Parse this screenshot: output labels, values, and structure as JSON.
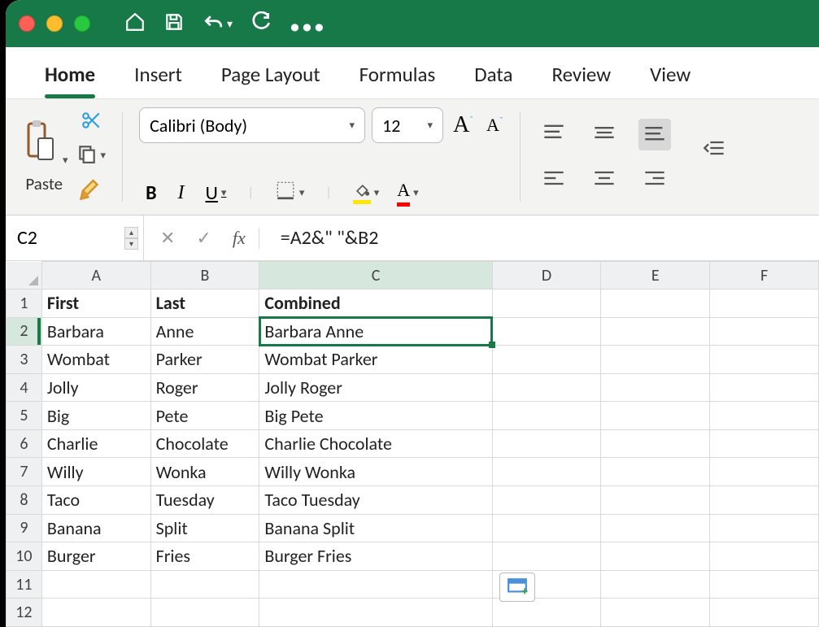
{
  "titlebar": {
    "traffic": [
      "red",
      "yellow",
      "green"
    ]
  },
  "tabs": {
    "items": [
      "Home",
      "Insert",
      "Page Layout",
      "Formulas",
      "Data",
      "Review",
      "View"
    ],
    "active": 0
  },
  "ribbon": {
    "paste_label": "Paste",
    "font_name": "Calibri (Body)",
    "font_size": "12",
    "bold": "B",
    "italic": "I",
    "underline": "U"
  },
  "namebox": "C2",
  "formula": "=A2&\" \"&B2",
  "fx_label": "fx",
  "columns": [
    "A",
    "B",
    "C",
    "D",
    "E",
    "F"
  ],
  "selected_col_index": 2,
  "selected_row_index": 1,
  "rows": [
    {
      "n": 1,
      "cells": [
        "First",
        "Last",
        "Combined",
        "",
        "",
        ""
      ],
      "bold": true
    },
    {
      "n": 2,
      "cells": [
        "Barbara",
        "Anne",
        "Barbara Anne",
        "",
        "",
        ""
      ]
    },
    {
      "n": 3,
      "cells": [
        "Wombat",
        "Parker",
        "Wombat Parker",
        "",
        "",
        ""
      ]
    },
    {
      "n": 4,
      "cells": [
        "Jolly",
        "Roger",
        "Jolly Roger",
        "",
        "",
        ""
      ]
    },
    {
      "n": 5,
      "cells": [
        "Big",
        "Pete",
        "Big Pete",
        "",
        "",
        ""
      ]
    },
    {
      "n": 6,
      "cells": [
        "Charlie",
        "Chocolate",
        "Charlie Chocolate",
        "",
        "",
        ""
      ]
    },
    {
      "n": 7,
      "cells": [
        "Willy",
        "Wonka",
        "Willy Wonka",
        "",
        "",
        ""
      ]
    },
    {
      "n": 8,
      "cells": [
        "Taco",
        "Tuesday",
        "Taco Tuesday",
        "",
        "",
        ""
      ]
    },
    {
      "n": 9,
      "cells": [
        "Banana",
        "Split",
        "Banana Split",
        "",
        "",
        ""
      ]
    },
    {
      "n": 10,
      "cells": [
        "Burger",
        "Fries",
        "Burger Fries",
        "",
        "",
        ""
      ]
    },
    {
      "n": 11,
      "cells": [
        "",
        "",
        "",
        "",
        "",
        ""
      ]
    },
    {
      "n": 12,
      "cells": [
        "",
        "",
        "",
        "",
        "",
        ""
      ]
    }
  ],
  "colors": {
    "accent": "#177848"
  }
}
